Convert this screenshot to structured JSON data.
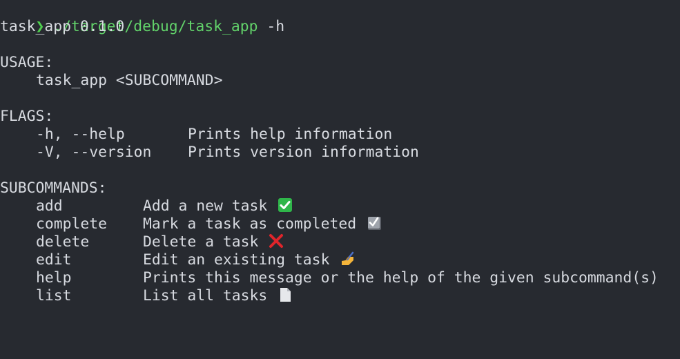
{
  "prompt": {
    "symbol": "❯",
    "command": "./target/debug/task_app",
    "flag": " -h"
  },
  "version_line": "task_app 0.1.0",
  "usage": {
    "heading": "USAGE:",
    "text": "task_app <SUBCOMMAND>"
  },
  "flags": {
    "heading": "FLAGS:",
    "items": [
      {
        "flag": "-h, --help",
        "desc": "Prints help information"
      },
      {
        "flag": "-V, --version",
        "desc": "Prints version information"
      }
    ]
  },
  "subcommands": {
    "heading": "SUBCOMMANDS:",
    "items": [
      {
        "name": "add",
        "desc": "Add a new task",
        "icon": "check-mark-button-icon"
      },
      {
        "name": "complete",
        "desc": "Mark a task as completed",
        "icon": "ballot-box-check-icon"
      },
      {
        "name": "delete",
        "desc": "Delete a task",
        "icon": "cross-mark-icon"
      },
      {
        "name": "edit",
        "desc": "Edit an existing task",
        "icon": "writing-hand-icon"
      },
      {
        "name": "help",
        "desc": "Prints this message or the help of the given subcommand(s)",
        "icon": ""
      },
      {
        "name": "list",
        "desc": "List all tasks",
        "icon": "page-icon"
      }
    ]
  },
  "colors": {
    "background": "#272a30",
    "text": "#d7dae0",
    "prompt_green": "#62d26a"
  }
}
